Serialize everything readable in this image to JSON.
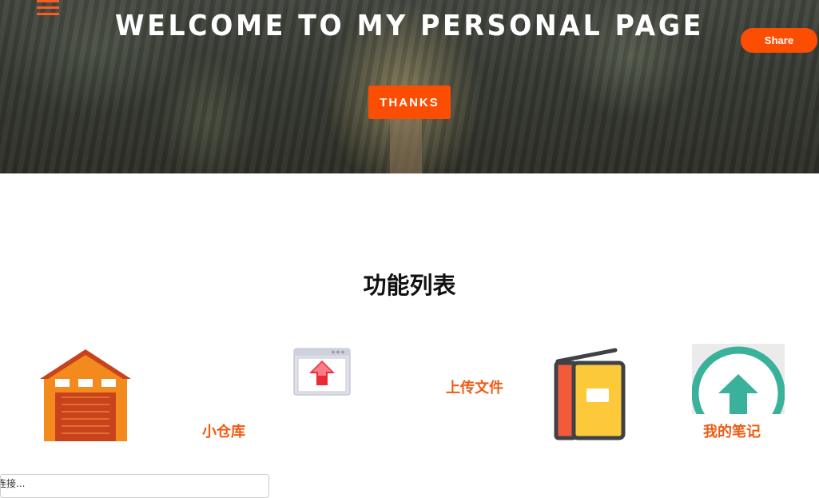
{
  "header": {
    "title": "WELCOME TO MY PERSONAL PAGE",
    "share_label": "Share",
    "thanks_label": "THANKS",
    "accent_color": "#fc4e03"
  },
  "features": {
    "title": "功能列表",
    "items": [
      {
        "label": "小仓库",
        "icon": "warehouse-icon"
      },
      {
        "label": "上传文件",
        "icon": "upload-window-icon"
      },
      {
        "label": "我的笔记",
        "icon": "notebook-icon"
      },
      {
        "label": "",
        "icon": "upload-circle-icon"
      }
    ]
  },
  "status_bar": {
    "text": "连接..."
  }
}
